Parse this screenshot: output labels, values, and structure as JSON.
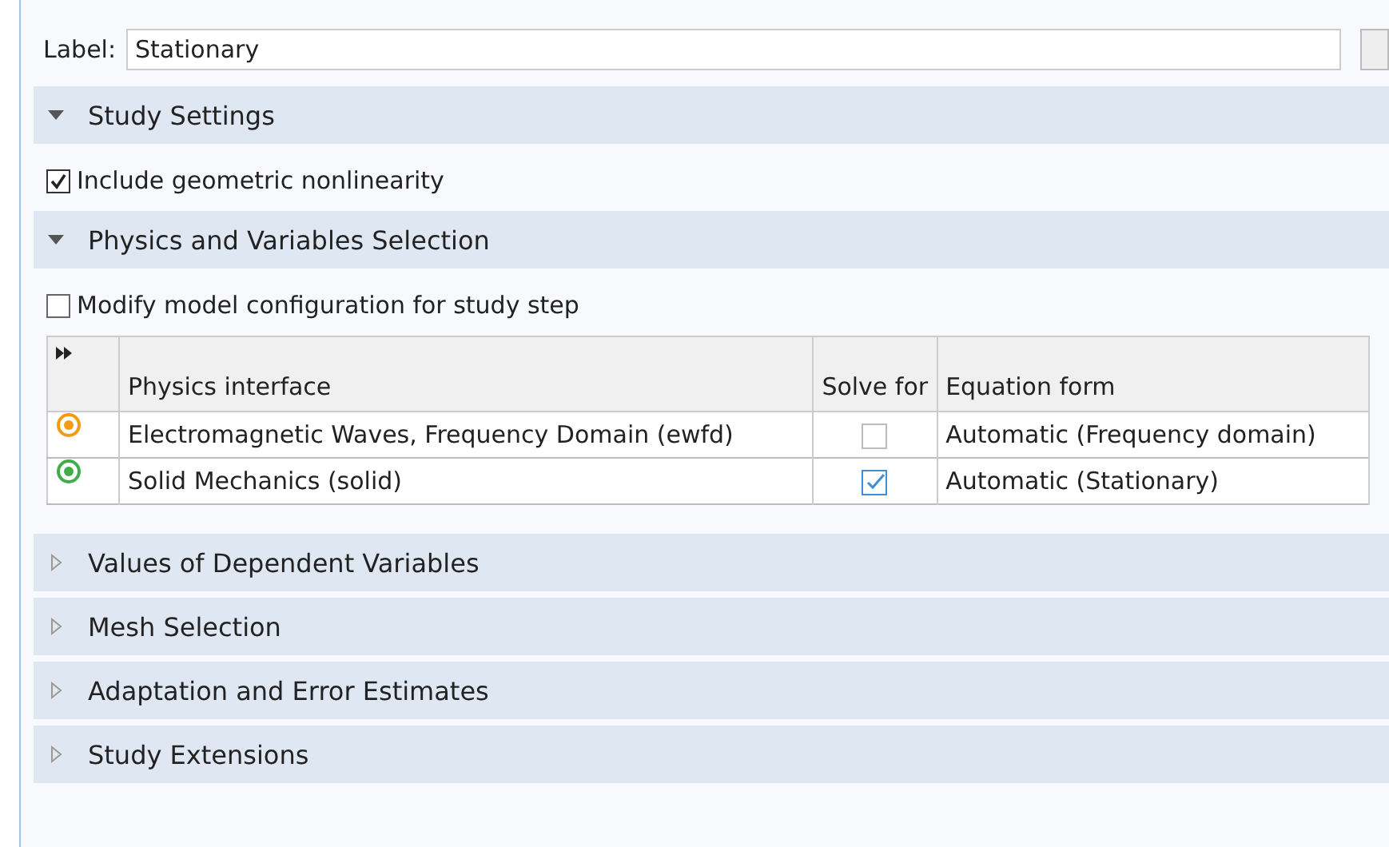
{
  "label": {
    "caption": "Label:",
    "value": "Stationary"
  },
  "sections": [
    {
      "title": "Study Settings",
      "expanded": true,
      "items": [
        {
          "kind": "checkbox",
          "text": "Include geometric nonlinearity",
          "checked": true
        }
      ]
    },
    {
      "title": "Physics and Variables Selection",
      "expanded": true,
      "items": [
        {
          "kind": "checkbox",
          "text": "Modify model configuration for study step",
          "checked": false
        },
        {
          "kind": "table",
          "columns": [
            "Physics interface",
            "Solve for",
            "Equation form"
          ],
          "rows": [
            {
              "color": "#f39c12",
              "interface": "Electromagnetic Waves, Frequency Domain (ewfd)",
              "solve_for": false,
              "equation_form": "Automatic (Frequency domain)"
            },
            {
              "color": "#3fae49",
              "interface": "Solid Mechanics (solid)",
              "solve_for": true,
              "equation_form": "Automatic (Stationary)"
            }
          ]
        }
      ]
    },
    {
      "title": "Values of Dependent Variables",
      "expanded": false
    },
    {
      "title": "Mesh Selection",
      "expanded": false
    },
    {
      "title": "Adaptation and Error Estimates",
      "expanded": false
    },
    {
      "title": "Study Extensions",
      "expanded": false
    }
  ]
}
